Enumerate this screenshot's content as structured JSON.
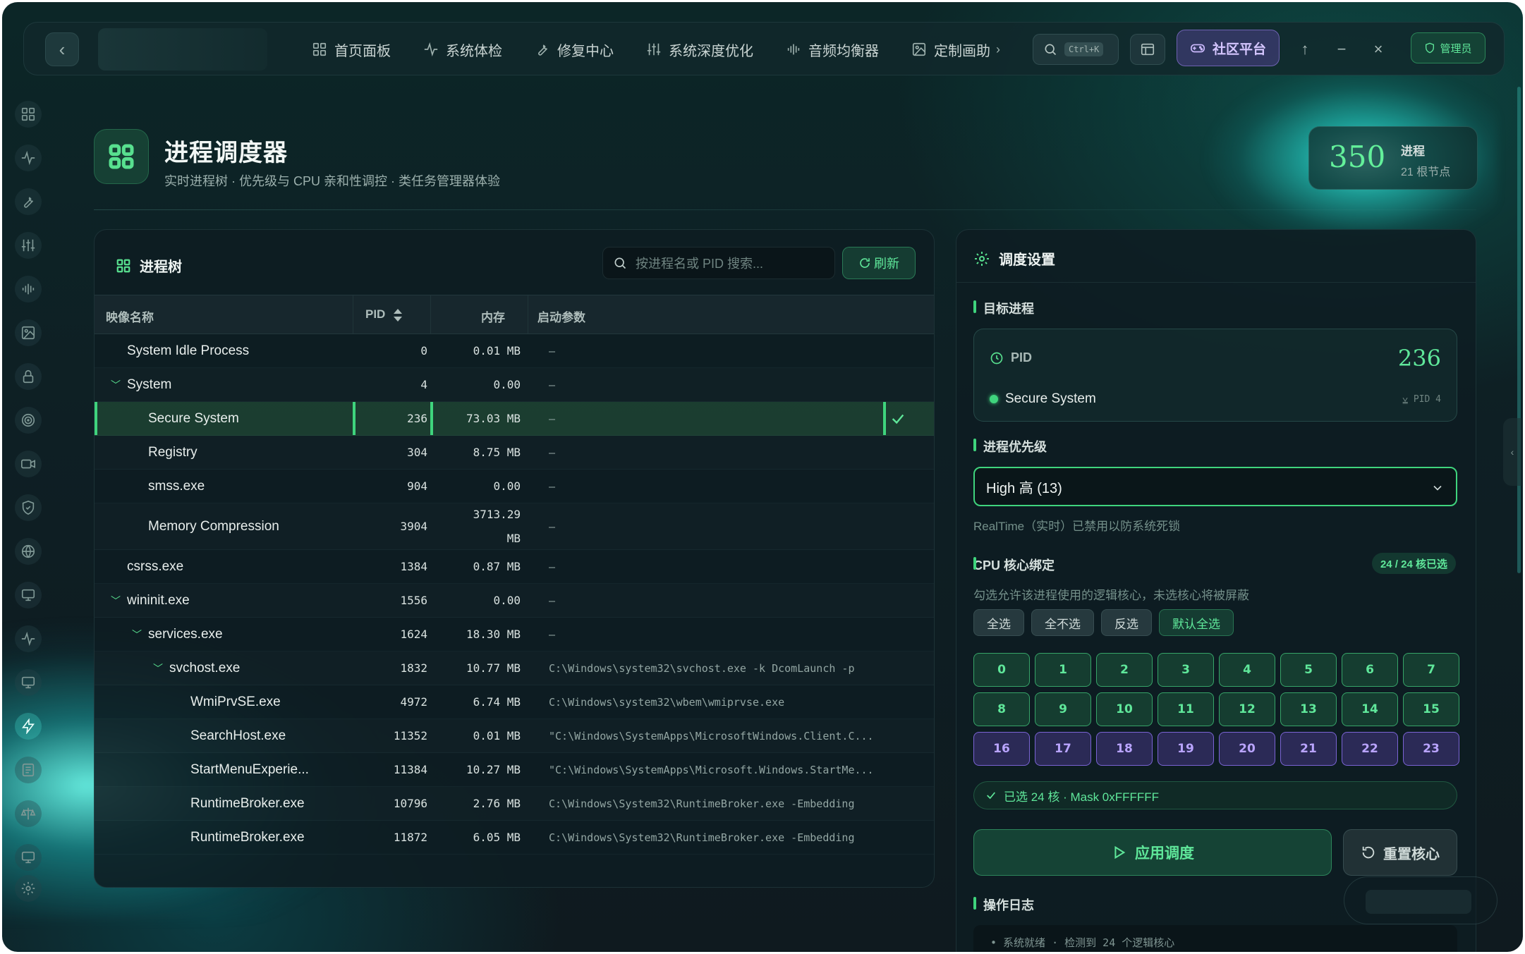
{
  "colors": {
    "accent_green": "#3fd47d",
    "accent_purple": "#9678ff",
    "background": "#0e1f24"
  },
  "nav": {
    "items": [
      {
        "label": "首页面板",
        "icon": "grid-icon"
      },
      {
        "label": "系统体检",
        "icon": "pulse-icon"
      },
      {
        "label": "修复中心",
        "icon": "wrench-icon"
      },
      {
        "label": "系统深度优化",
        "icon": "sliders-icon"
      },
      {
        "label": "音频均衡器",
        "icon": "equalizer-icon"
      },
      {
        "label": "定制画助",
        "icon": "image-icon"
      }
    ],
    "search_shortcut": "Ctrl+K",
    "community_label": "社区平台",
    "admin_label": "管理员"
  },
  "sidebar_icons": [
    "grid-icon",
    "pulse-icon",
    "wrench-icon",
    "sliders-icon",
    "equalizer-icon",
    "image-icon",
    "lock-icon",
    "target-icon",
    "video-icon",
    "shield-icon",
    "globe-icon",
    "monitor-icon",
    "pulse-icon",
    "monitor-icon",
    "bolt-icon",
    "list-icon",
    "scale-icon",
    "monitor-icon",
    "gear-icon"
  ],
  "header": {
    "title": "进程调度器",
    "subtitle": "实时进程树 · 优先级与 CPU 亲和性调控 · 类任务管理器体验",
    "stat_value": "350",
    "stat_label": "进程",
    "stat_sub": "21 根节点"
  },
  "tree_panel": {
    "title": "进程树",
    "search_placeholder": "按进程名或 PID 搜索...",
    "refresh_label": "刷新",
    "columns": {
      "name": "映像名称",
      "pid": "PID",
      "memory": "内存",
      "args": "启动参数"
    },
    "rows": [
      {
        "name": "System Idle Process",
        "indent": 0,
        "expand": false,
        "pid": "0",
        "mem": "0.01 MB",
        "args": "—"
      },
      {
        "name": "System",
        "indent": 0,
        "expand": true,
        "pid": "4",
        "mem": "0.00",
        "args": "—"
      },
      {
        "name": "Secure System",
        "indent": 1,
        "expand": false,
        "pid": "236",
        "mem": "73.03 MB",
        "args": "—",
        "selected": true
      },
      {
        "name": "Registry",
        "indent": 1,
        "expand": false,
        "pid": "304",
        "mem": "8.75 MB",
        "args": "—"
      },
      {
        "name": "smss.exe",
        "indent": 1,
        "expand": false,
        "pid": "904",
        "mem": "0.00",
        "args": "—"
      },
      {
        "name": "Memory Compression",
        "indent": 1,
        "expand": false,
        "pid": "3904",
        "mem": "3713.29\nMB",
        "args": "—",
        "tall": true
      },
      {
        "name": "csrss.exe",
        "indent": 0,
        "expand": false,
        "pid": "1384",
        "mem": "0.87 MB",
        "args": "—"
      },
      {
        "name": "wininit.exe",
        "indent": 0,
        "expand": true,
        "pid": "1556",
        "mem": "0.00",
        "args": "—"
      },
      {
        "name": "services.exe",
        "indent": 1,
        "expand": true,
        "pid": "1624",
        "mem": "18.30 MB",
        "args": "—"
      },
      {
        "name": "svchost.exe",
        "indent": 2,
        "expand": true,
        "pid": "1832",
        "mem": "10.77 MB",
        "args": "C:\\Windows\\system32\\svchost.exe -k DcomLaunch -p"
      },
      {
        "name": "WmiPrvSE.exe",
        "indent": 3,
        "expand": false,
        "pid": "4972",
        "mem": "6.74 MB",
        "args": "C:\\Windows\\system32\\wbem\\wmiprvse.exe"
      },
      {
        "name": "SearchHost.exe",
        "indent": 3,
        "expand": false,
        "pid": "11352",
        "mem": "0.01 MB",
        "args": "\"C:\\Windows\\SystemApps\\MicrosoftWindows.Client.C..."
      },
      {
        "name": "StartMenuExperie...",
        "indent": 3,
        "expand": false,
        "pid": "11384",
        "mem": "10.27 MB",
        "args": "\"C:\\Windows\\SystemApps\\Microsoft.Windows.StartMe..."
      },
      {
        "name": "RuntimeBroker.exe",
        "indent": 3,
        "expand": false,
        "pid": "10796",
        "mem": "2.76 MB",
        "args": "C:\\Windows\\System32\\RuntimeBroker.exe -Embedding"
      },
      {
        "name": "RuntimeBroker.exe",
        "indent": 3,
        "expand": false,
        "pid": "11872",
        "mem": "6.05 MB",
        "args": "C:\\Windows\\System32\\RuntimeBroker.exe -Embedding"
      }
    ]
  },
  "settings_panel": {
    "title": "调度设置",
    "target_label": "目标进程",
    "pid_label": "PID",
    "pid_value": "236",
    "process_name": "Secure System",
    "parent_pid": "PID 4",
    "priority_label": "进程优先级",
    "priority_value": "High 高 (13)",
    "priority_hint": "RealTime（实时）已禁用以防系统死锁",
    "cpu_label": "CPU 核心绑定",
    "cpu_badge": "24 / 24 核已选",
    "cpu_hint": "勾选允许该进程使用的逻辑核心，未选核心将被屏蔽",
    "cpu_buttons": [
      "全选",
      "全不选",
      "反选",
      "默认全选"
    ],
    "cores": [
      "0",
      "1",
      "2",
      "3",
      "4",
      "5",
      "6",
      "7",
      "8",
      "9",
      "10",
      "11",
      "12",
      "13",
      "14",
      "15",
      "16",
      "17",
      "18",
      "19",
      "20",
      "21",
      "22",
      "23"
    ],
    "mask_text": "已选 24 核 · Mask 0xFFFFFF",
    "apply_label": "应用调度",
    "reset_label": "重置核心",
    "log_label": "操作日志",
    "log_line": "• 系统就绪 · 检测到 24 个逻辑核心"
  }
}
